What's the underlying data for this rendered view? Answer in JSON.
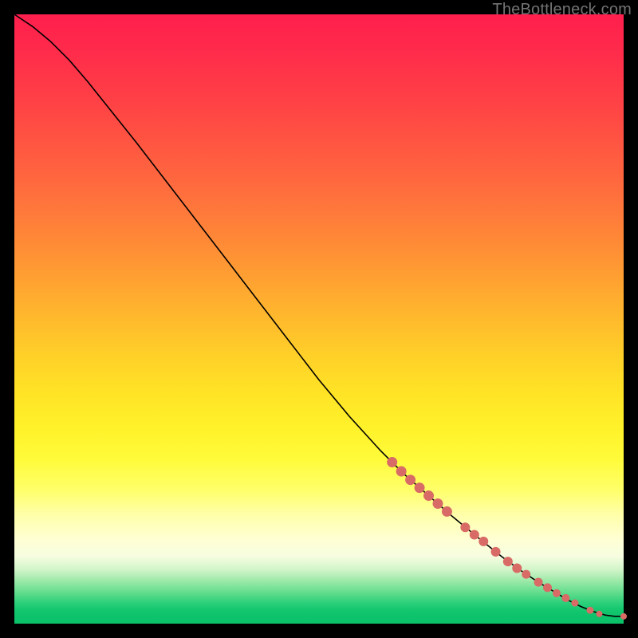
{
  "watermark": "TheBottleneck.com",
  "chart_data": {
    "type": "line",
    "title": "",
    "xlabel": "",
    "ylabel": "",
    "xlim": [
      0,
      100
    ],
    "ylim": [
      0,
      100
    ],
    "grid": false,
    "legend": false,
    "background_gradient": {
      "direction": "vertical",
      "stops": [
        {
          "pos": 0.0,
          "color": "#ff1f4d"
        },
        {
          "pos": 0.28,
          "color": "#ff6a3e"
        },
        {
          "pos": 0.56,
          "color": "#ffd028"
        },
        {
          "pos": 0.78,
          "color": "#ffff69"
        },
        {
          "pos": 0.9,
          "color": "#d4f5cb"
        },
        {
          "pos": 1.0,
          "color": "#0bc169"
        }
      ]
    },
    "series": [
      {
        "name": "main-curve",
        "x": [
          0,
          3,
          6,
          9,
          12,
          16,
          20,
          25,
          30,
          35,
          40,
          45,
          50,
          55,
          60,
          64,
          68,
          72,
          76,
          80,
          83,
          86,
          89,
          91,
          93,
          95,
          97,
          98.5,
          100
        ],
        "y": [
          100,
          98,
          95.5,
          92.5,
          89,
          84,
          79,
          72.5,
          66,
          59.5,
          53,
          46.5,
          40,
          34,
          28.5,
          24.5,
          21,
          17.5,
          14.2,
          11,
          8.8,
          6.8,
          5.0,
          3.8,
          2.8,
          2.0,
          1.4,
          1.2,
          1.2
        ]
      }
    ],
    "markers": [
      {
        "x": 62.0,
        "y": 26.5,
        "r": 6.5
      },
      {
        "x": 63.5,
        "y": 25.0,
        "r": 6.5
      },
      {
        "x": 65.0,
        "y": 23.6,
        "r": 6.5
      },
      {
        "x": 66.5,
        "y": 22.3,
        "r": 6.5
      },
      {
        "x": 68.0,
        "y": 21.0,
        "r": 6.5
      },
      {
        "x": 69.5,
        "y": 19.7,
        "r": 6.5
      },
      {
        "x": 71.0,
        "y": 18.4,
        "r": 6.5
      },
      {
        "x": 74.0,
        "y": 15.8,
        "r": 6.0
      },
      {
        "x": 75.5,
        "y": 14.6,
        "r": 6.0
      },
      {
        "x": 77.0,
        "y": 13.5,
        "r": 6.0
      },
      {
        "x": 79.0,
        "y": 11.8,
        "r": 6.0
      },
      {
        "x": 81.0,
        "y": 10.2,
        "r": 6.0
      },
      {
        "x": 82.5,
        "y": 9.1,
        "r": 6.0
      },
      {
        "x": 84.0,
        "y": 8.1,
        "r": 5.5
      },
      {
        "x": 86.0,
        "y": 6.8,
        "r": 5.5
      },
      {
        "x": 87.5,
        "y": 5.9,
        "r": 5.5
      },
      {
        "x": 89.0,
        "y": 5.0,
        "r": 5.0
      },
      {
        "x": 90.5,
        "y": 4.2,
        "r": 5.0
      },
      {
        "x": 92.0,
        "y": 3.4,
        "r": 4.5
      },
      {
        "x": 94.5,
        "y": 2.2,
        "r": 4.5
      },
      {
        "x": 96.0,
        "y": 1.6,
        "r": 4.0
      },
      {
        "x": 100.0,
        "y": 1.2,
        "r": 4.0
      }
    ],
    "marker_color": "#d86b65"
  }
}
